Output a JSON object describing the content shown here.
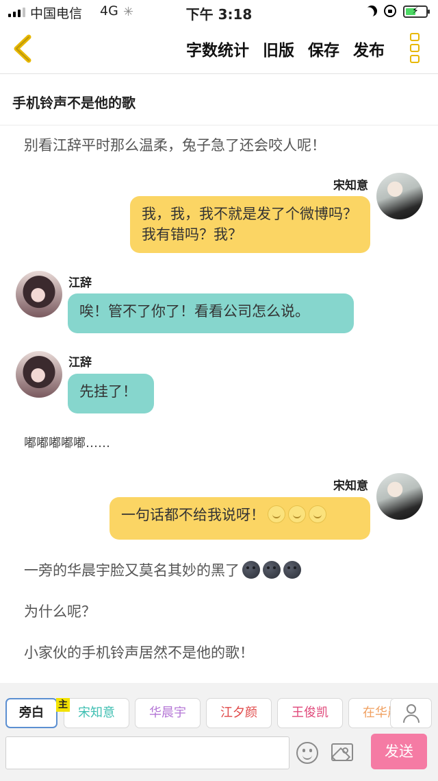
{
  "status_bar": {
    "carrier": "中国电信",
    "network": "4G",
    "time": "下午 3:18"
  },
  "toolbar": {
    "actions": [
      "字数统计",
      "旧版",
      "保存",
      "发布"
    ]
  },
  "title": "手机铃声不是他的歌",
  "chat": {
    "narration_top": "别看江辞平时那么温柔，兔子急了还会咬人呢！",
    "msg1": {
      "speaker": "宋知意",
      "text": "我，我，我不就是发了个微博吗？我有错吗？我？"
    },
    "msg2": {
      "speaker": "江辞",
      "text": "唉！管不了你了！看看公司怎么说。"
    },
    "msg3": {
      "speaker": "江辞",
      "text": "先挂了！"
    },
    "narration_beep": "嘟嘟嘟嘟嘟……",
    "msg4": {
      "speaker": "宋知意",
      "text": "一句话都不给我说呀！"
    },
    "narration_1": "一旁的华晨宇脸又莫名其妙的黑了",
    "narration_2": "为什么呢？",
    "narration_3": "小家伙的手机铃声居然不是他的歌！"
  },
  "roles": [
    {
      "name": "旁白",
      "color": "#222222"
    },
    {
      "name": "宋知意",
      "color": "#3fbfb2"
    },
    {
      "name": "华晨宇",
      "color": "#b476d6"
    },
    {
      "name": "江夕颜",
      "color": "#e04848"
    },
    {
      "name": "王俊凯",
      "color": "#e0487a"
    },
    {
      "name": "在华晨",
      "color": "#f0a060"
    }
  ],
  "host_badge": "主",
  "composer": {
    "value": "",
    "send_label": "发送"
  },
  "colors": {
    "yellow_bubble": "#fbd564",
    "teal_bubble": "#86d6cd",
    "send_button": "#f57ba4"
  }
}
